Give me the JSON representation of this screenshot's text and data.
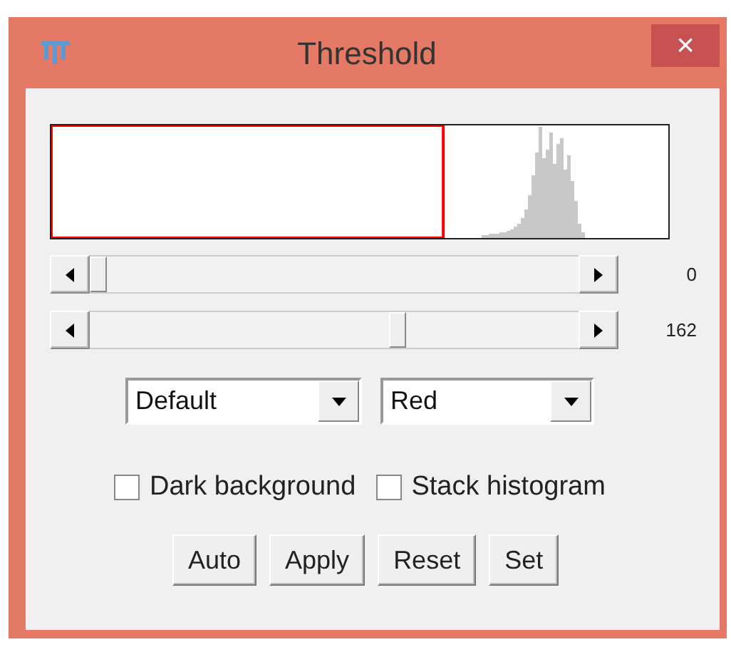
{
  "window": {
    "title": "Threshold",
    "close": "×"
  },
  "sliders": [
    {
      "reading": "0"
    },
    {
      "reading": "162"
    }
  ],
  "dropdowns": [
    {
      "value": "Default"
    },
    {
      "value": "Red"
    }
  ],
  "checkboxes": [
    {
      "label": "Dark background",
      "checked": false
    },
    {
      "label": "Stack histogram",
      "checked": false
    }
  ],
  "buttons": [
    "Auto",
    "Apply",
    "Reset",
    "Set"
  ]
}
